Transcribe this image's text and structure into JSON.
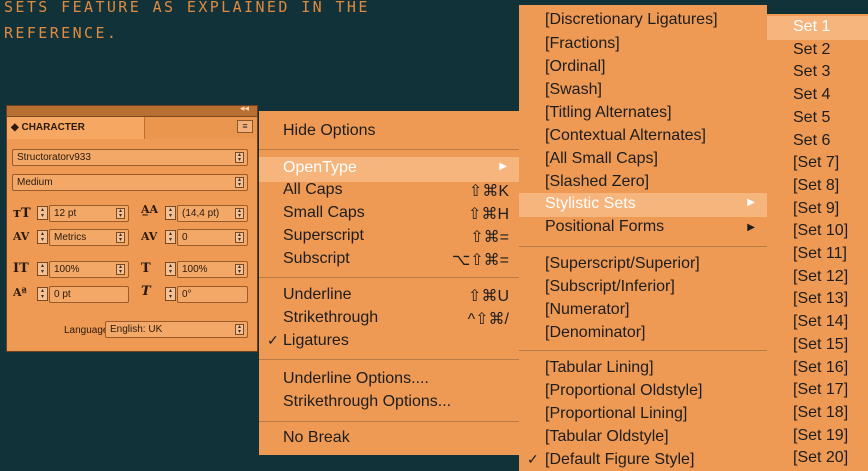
{
  "caption": {
    "line1": "SETS FEATURE AS EXPLAINED IN THE",
    "line2": "REFERENCE."
  },
  "panel": {
    "tab_label": "◆ CHARACTER",
    "font_family": "Structoratorv933",
    "font_style": "Medium",
    "font_size": "12 pt",
    "leading": "(14,4 pt)",
    "kerning": "Metrics",
    "tracking": "0",
    "vertical_scale": "100%",
    "horizontal_scale": "100%",
    "baseline_shift": "0 pt",
    "skew": "0°",
    "language_label": "Language:",
    "language_value": "English: UK"
  },
  "menu1": {
    "items": [
      {
        "label": "Hide Options",
        "shortcut": ""
      },
      {
        "label": "OpenType",
        "shortcut": ""
      },
      {
        "label": "All Caps",
        "shortcut": "⇧⌘K"
      },
      {
        "label": "Small Caps",
        "shortcut": "⇧⌘H"
      },
      {
        "label": "Superscript",
        "shortcut": "⇧⌘="
      },
      {
        "label": "Subscript",
        "shortcut": "⌥⇧⌘="
      },
      {
        "label": "Underline",
        "shortcut": "⇧⌘U"
      },
      {
        "label": "Strikethrough",
        "shortcut": "^⇧⌘/"
      },
      {
        "label": "Ligatures",
        "shortcut": ""
      },
      {
        "label": "Underline Options....",
        "shortcut": ""
      },
      {
        "label": "Strikethrough Options...",
        "shortcut": ""
      },
      {
        "label": "No Break",
        "shortcut": ""
      }
    ],
    "checked_item": "Ligatures",
    "highlighted_item": "OpenType"
  },
  "menu2": {
    "items": [
      "[Discretionary Ligatures]",
      "[Fractions]",
      "[Ordinal]",
      "[Swash]",
      "[Titling Alternates]",
      "[Contextual Alternates]",
      "[All Small Caps]",
      "[Slashed Zero]",
      "Stylistic Sets",
      "Positional Forms",
      "[Superscript/Superior]",
      "[Subscript/Inferior]",
      "[Numerator]",
      "[Denominator]",
      "[Tabular Lining]",
      "[Proportional Oldstyle]",
      "[Proportional Lining]",
      "[Tabular Oldstyle]",
      "[Default Figure Style]"
    ],
    "highlighted_item": "Stylistic Sets",
    "checked_item": "[Default Figure Style]"
  },
  "menu3": {
    "items": [
      "Set 1",
      "Set 2",
      "Set 3",
      "Set 4",
      "Set 5",
      "Set 6",
      "[Set 7]",
      "[Set 8]",
      "[Set 9]",
      "[Set 10]",
      "[Set 11]",
      "[Set 12]",
      "[Set 13]",
      "[Set 14]",
      "[Set 15]",
      "[Set 16]",
      "[Set 17]",
      "[Set 18]",
      "[Set 19]",
      "[Set 20]"
    ],
    "highlighted_item": "Set 1"
  },
  "colors": {
    "background": "#12323a",
    "menu": "#ee9a54",
    "highlight": "#f6b57c",
    "caption": "#e08a3e"
  }
}
